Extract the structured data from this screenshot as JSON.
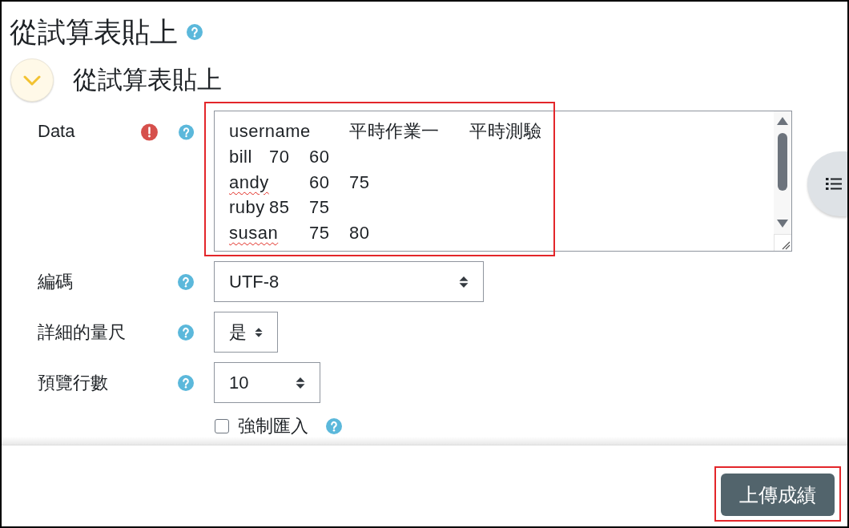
{
  "page": {
    "title": "從試算表貼上",
    "help": true
  },
  "section": {
    "title": "從試算表貼上",
    "expanded": true
  },
  "fields": [
    {
      "kind": "textarea",
      "label": "Data",
      "error": true,
      "help": true,
      "highlighted": true,
      "lines": [
        {
          "cells": [
            {
              "text": "username",
              "flagged": false
            },
            {
              "text": "平時作業一",
              "flagged": false
            },
            {
              "text": "平時測驗",
              "flagged": false
            }
          ]
        },
        {
          "cells": [
            {
              "text": "bill",
              "flagged": false
            },
            {
              "text": "70",
              "flagged": false
            },
            {
              "text": "60",
              "flagged": false
            }
          ]
        },
        {
          "cells": [
            {
              "text": "andy",
              "flagged": true
            },
            {
              "text": "60",
              "flagged": false
            },
            {
              "text": "75",
              "flagged": false
            }
          ]
        },
        {
          "cells": [
            {
              "text": "ruby",
              "flagged": false
            },
            {
              "text": "85",
              "flagged": false
            },
            {
              "text": "75",
              "flagged": false
            }
          ]
        },
        {
          "cells": [
            {
              "text": "susan",
              "flagged": true
            },
            {
              "text": "75",
              "flagged": false
            },
            {
              "text": "80",
              "flagged": false
            }
          ]
        }
      ]
    },
    {
      "kind": "select",
      "label": "編碼",
      "value": "UTF-8",
      "error": false,
      "help": true,
      "highlighted": false
    },
    {
      "kind": "select",
      "label": "詳細的量尺",
      "value": "是",
      "error": false,
      "help": true,
      "highlighted": false
    },
    {
      "kind": "select",
      "label": "預覽行數",
      "value": "10",
      "error": false,
      "help": true,
      "highlighted": false
    },
    {
      "kind": "checkbox",
      "label": "強制匯入",
      "checked": false,
      "error": false,
      "help": true,
      "highlighted": false
    }
  ],
  "submit_button": {
    "label": "上傳成績",
    "highlighted": true
  }
}
